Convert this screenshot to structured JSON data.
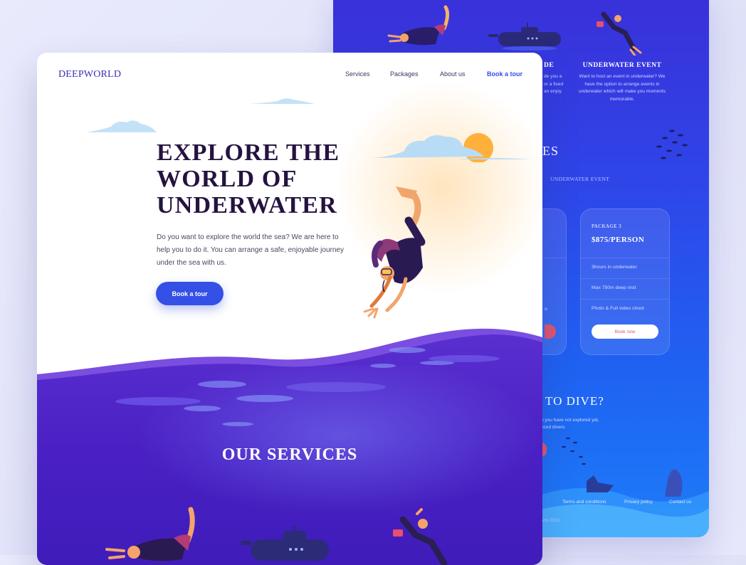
{
  "back": {
    "service_partial_title": "DE",
    "service_partial_desc": [
      "de you a",
      "or a fixed",
      "an enjoy"
    ],
    "service_event_title": "UNDERWATER EVENT",
    "service_event_desc": "Want to host an event in underwater? We have the option to arrange events in underwater which will make you moments memorable.",
    "packages_title_partial": "ES",
    "packages_tab": "UNDERWATER EVENT",
    "package_left_partial_text": "o",
    "package3": {
      "label": "PACKAGE 3",
      "price": "$875/PERSON",
      "features": [
        "3hours in underwater",
        "Max 750m deep visit",
        "Photo & Full video shoot"
      ],
      "button": "Book now"
    },
    "dive_title_partial": "TO DIVE?",
    "dive_desc_partial": [
      "n you have not explored yet,",
      "nced divers."
    ],
    "footer_links": [
      "Terms and conditions",
      "Privacy policy",
      "Contact us"
    ],
    "copyright_partial": "ami 2021"
  },
  "front": {
    "logo": "DEEPWORLD",
    "nav": [
      "Services",
      "Packages",
      "About us",
      "Book a tour"
    ],
    "hero_title_lines": [
      "EXPLORE THE",
      "WORLD OF",
      "UNDERWATER"
    ],
    "hero_desc": "Do you want to explore the world the sea? We are here to help you to do it. You can arrange a safe, enjoyable journey under the sea with us.",
    "hero_button": "Book a tour",
    "services_title": "OUR SERVICES"
  },
  "colors": {
    "brand_blue": "#3450e6",
    "ocean_purple": "#4a1fc4",
    "title_dark": "#25123f",
    "sun": "#ffae3a",
    "cloud": "#bfe0f7"
  }
}
